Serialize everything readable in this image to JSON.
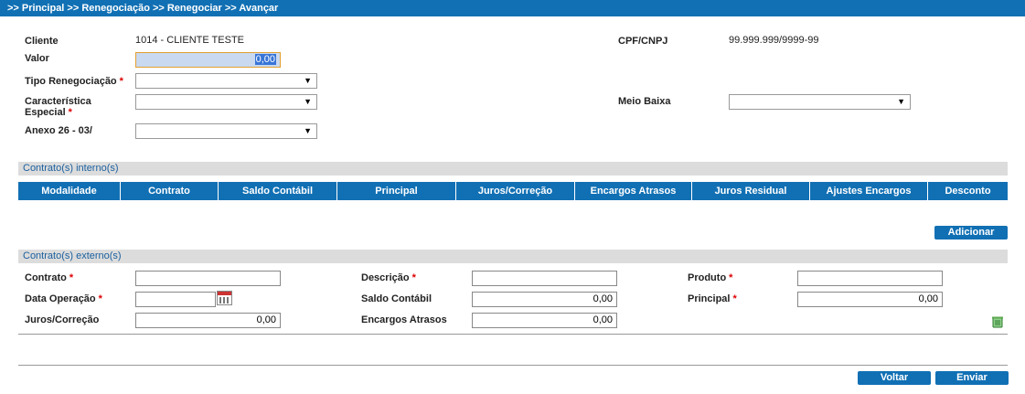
{
  "breadcrumb": ">> Principal >> Renegociação >> Renegociar >> Avançar",
  "header": {
    "cliente_label": "Cliente",
    "cliente_value": "1014 - CLIENTE TESTE",
    "cpf_label": "CPF/CNPJ",
    "cpf_value": "99.999.999/9999-99",
    "valor_label": "Valor",
    "valor_value": "0,00",
    "tipo_label": "Tipo Renegociação",
    "caracteristica_label_1": "Característica",
    "caracteristica_label_2": "Especial",
    "meio_baixa_label": "Meio Baixa",
    "anexo_label": "Anexo 26 - 03/",
    "required_mark": "*"
  },
  "internos": {
    "title": "Contrato(s) interno(s)",
    "columns": [
      "Modalidade",
      "Contrato",
      "Saldo Contábil",
      "Principal",
      "Juros/Correção",
      "Encargos Atrasos",
      "Juros Residual",
      "Ajustes Encargos",
      "Desconto"
    ],
    "add_button": "Adicionar"
  },
  "externos": {
    "title": "Contrato(s) externo(s)",
    "contrato_label": "Contrato",
    "descricao_label": "Descrição",
    "produto_label": "Produto",
    "data_label": "Data Operação",
    "saldo_label": "Saldo Contábil",
    "saldo_value": "0,00",
    "principal_label": "Principal",
    "principal_value": "0,00",
    "juros_label": "Juros/Correção",
    "juros_value": "0,00",
    "encargos_label": "Encargos Atrasos",
    "encargos_value": "0,00"
  },
  "footer": {
    "voltar": "Voltar",
    "enviar": "Enviar"
  },
  "icons": {
    "calendar": "calendar-icon",
    "trash": "trash-icon",
    "dropdown": "chevron-down-icon"
  },
  "colors": {
    "brand": "#1170b4",
    "section_bg": "#dcdcdc",
    "section_text": "#1a5f9e",
    "required": "#dd0000"
  }
}
